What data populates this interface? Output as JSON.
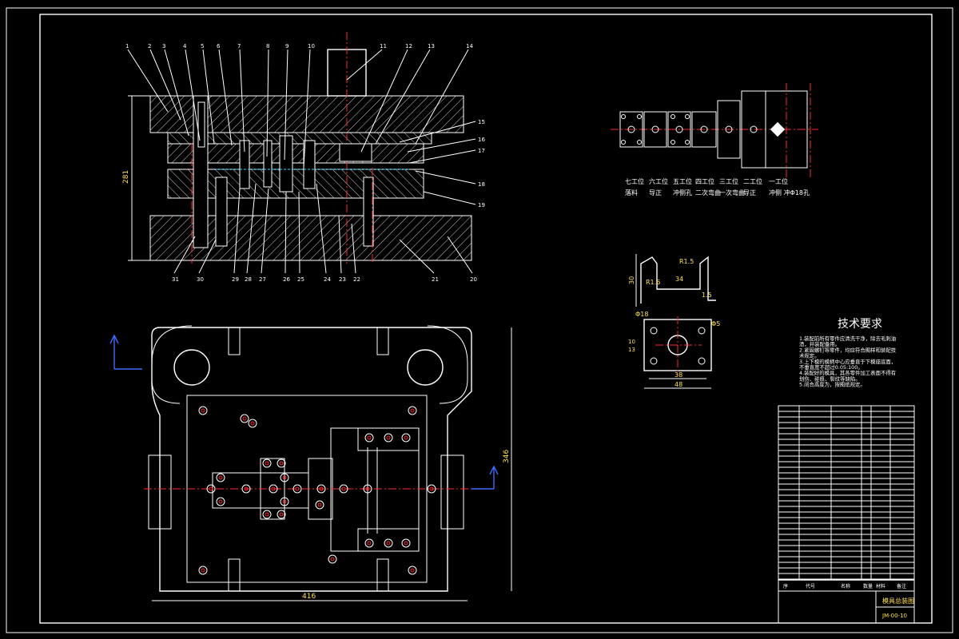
{
  "section_view": {
    "part_numbers_top": [
      "1",
      "2",
      "3",
      "4",
      "5",
      "6",
      "7",
      "8",
      "9",
      "10",
      "11",
      "12",
      "13",
      "14"
    ],
    "part_numbers_right": [
      "15",
      "16",
      "17",
      "18",
      "19"
    ],
    "part_numbers_bottom": [
      "31",
      "30",
      "29",
      "28",
      "27",
      "26",
      "25",
      "24",
      "23",
      "22",
      "21",
      "20"
    ],
    "height_dim": "281"
  },
  "plan_view": {
    "width_dim": "416",
    "height_dim": "346"
  },
  "strip_layout": {
    "stations": [
      {
        "name": "七工位",
        "op": "落料"
      },
      {
        "name": "六工位",
        "op": "导正"
      },
      {
        "name": "五工位",
        "op": "冲侧孔"
      },
      {
        "name": "四工位",
        "op": "二次弯曲"
      },
      {
        "name": "三工位",
        "op": "一次弯曲"
      },
      {
        "name": "二工位",
        "op": "导正"
      },
      {
        "name": "一工位",
        "op": "冲侧 冲Φ18孔"
      }
    ]
  },
  "part_drawing": {
    "dims": {
      "r1": "R1.5",
      "r2": "R1.6",
      "height": "30",
      "width": "34",
      "flange": "1.5",
      "hole": "Φ18",
      "hole2": "Φ5",
      "base": "38",
      "overall": "48",
      "side": "10",
      "side2": "13"
    }
  },
  "tech_requirements": {
    "title": "技术要求",
    "items": [
      "1.装配前所有零件应清洗干净，除去毛刺油",
      "  渍，并装配备用。",
      "2.紧固螺钉等零件，均应符合图样和装配技",
      "  术规定。",
      "3.上下模的模柄中心应垂直于下模座底面，",
      "  不垂直度不超过0.05:100。",
      "4.装配好的模具，其各零件加工表面不得有",
      "  划伤、碰痕、裂纹等缺陷。",
      "5.闭合高度为，按图纸规定。"
    ]
  },
  "title_block": {
    "drawing_name": "模具总装图",
    "drawing_code": "JM-00-10",
    "bom_header": [
      "序",
      "代号",
      "名称",
      "数量",
      "材料",
      "备注"
    ]
  },
  "colors": {
    "background": "#000000",
    "line": "#ffffff",
    "center": "#ff2a2a",
    "hidden": "#3bd6ff",
    "arrow": "#3b6bff",
    "label": "#ffe14a",
    "accent": "#5aff5a"
  }
}
